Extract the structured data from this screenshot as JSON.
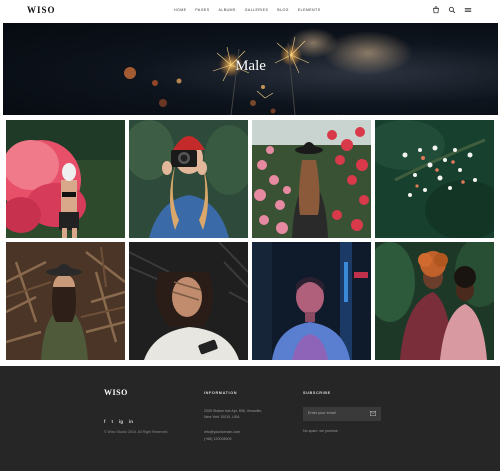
{
  "header": {
    "logo": "WISO",
    "nav": [
      "HOME",
      "PAGES",
      "ALBUMS",
      "GALLERIES",
      "BLOG",
      "ELEMENTS"
    ],
    "icons": [
      "cart-icon",
      "search-icon",
      "menu-icon"
    ]
  },
  "hero": {
    "title": "Male"
  },
  "gallery": {
    "photos": [
      "masked-woman-pink-smoke-photo",
      "woman-red-beanie-camera-photo",
      "woman-black-hat-roses-photo",
      "flowers-dark-green-photo",
      "woman-hat-branches-photo",
      "woman-lying-palm-shadow-photo",
      "man-neon-light-photo",
      "couple-curly-hair-photo"
    ]
  },
  "footer": {
    "logo": "WISO",
    "social": [
      "f",
      "t",
      "ig",
      "in"
    ],
    "copyright": "© Wiso Studio 2016. All Right Reserved.",
    "info_heading": "INFORMATION",
    "address_line1": "2005 Stokes Isle Apt. 896, Venaville,",
    "address_line2": "New York 10010, USA",
    "email": "info@yourdomain.com",
    "phone": "(+68) 120034509",
    "subscribe_heading": "SUBSCRIBE",
    "email_placeholder": "Enter your email",
    "spam_note": "No spam, we promise."
  }
}
